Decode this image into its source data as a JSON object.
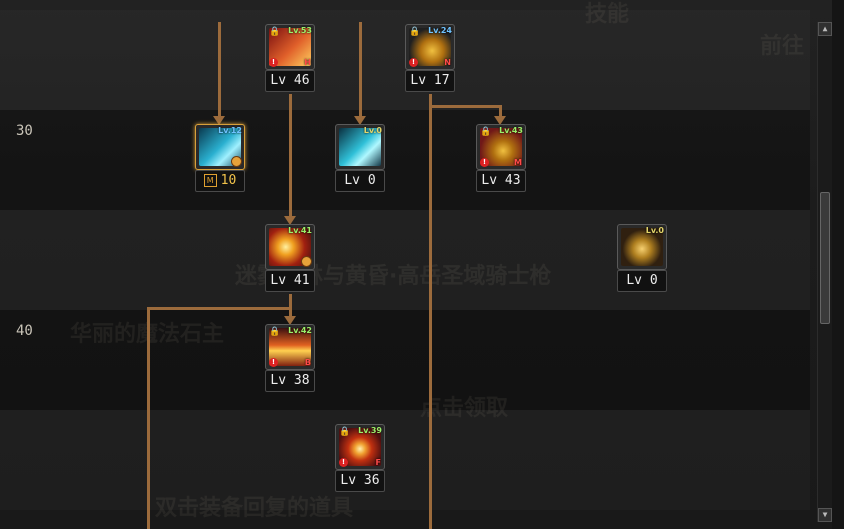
{
  "row_labels": {
    "row30": "30",
    "row40": "40"
  },
  "background_text": {
    "top_right": "前往",
    "top_center": "技能",
    "middle": "迷雾森林与黄昏·高岳圣域骑士枪",
    "left_middle": "华丽的魔法石主",
    "lower": "点击领取",
    "bottom": "双击装备回复的道具"
  },
  "skills": {
    "s1": {
      "icon": "flame-strike-icon",
      "tag": "Lv.53",
      "tag_color": "green",
      "locked": true,
      "warning": true,
      "badge": "H",
      "level_text": "Lv 46"
    },
    "s2": {
      "icon": "bell-shield-icon",
      "tag": "Lv.24",
      "tag_color": "blue",
      "locked": true,
      "warning": true,
      "badge": "N",
      "level_text": "Lv 17"
    },
    "s3": {
      "icon": "ice-hammer-icon",
      "tag": "Lv.12",
      "tag_color": "blue",
      "locked": false,
      "warning": false,
      "selected": true,
      "cooldown": true,
      "mastery_badge": "M",
      "level_value": "10"
    },
    "s4": {
      "icon": "ice-hammer-icon",
      "tag": "Lv.0",
      "tag_color": "yellow",
      "locked": false,
      "warning": false,
      "level_text": "Lv 0"
    },
    "s5": {
      "icon": "bell-shield-icon",
      "tag": "Lv.43",
      "tag_color": "green",
      "locked": true,
      "warning": true,
      "badge": "M",
      "level_text": "Lv 43"
    },
    "s6": {
      "icon": "fire-blast-icon",
      "tag": "Lv.41",
      "tag_color": "green",
      "locked": false,
      "warning": false,
      "cooldown": true,
      "level_text": "Lv 41"
    },
    "s7": {
      "icon": "golden-ring-icon",
      "tag": "Lv.0",
      "tag_color": "yellow",
      "locked": false,
      "warning": false,
      "level_text": "Lv 0"
    },
    "s8": {
      "icon": "flame-wave-icon",
      "tag": "Lv.42",
      "tag_color": "green",
      "locked": true,
      "warning": true,
      "badge": "B",
      "level_text": "Lv 38"
    },
    "s9": {
      "icon": "target-orb-icon",
      "tag": "Lv.39",
      "tag_color": "green",
      "locked": true,
      "warning": true,
      "badge": "F",
      "level_text": "Lv 36"
    }
  },
  "colors": {
    "connector": "#9c6b3c",
    "selected_border": "#d8a03a",
    "badge_red": "#ff4a4a"
  }
}
